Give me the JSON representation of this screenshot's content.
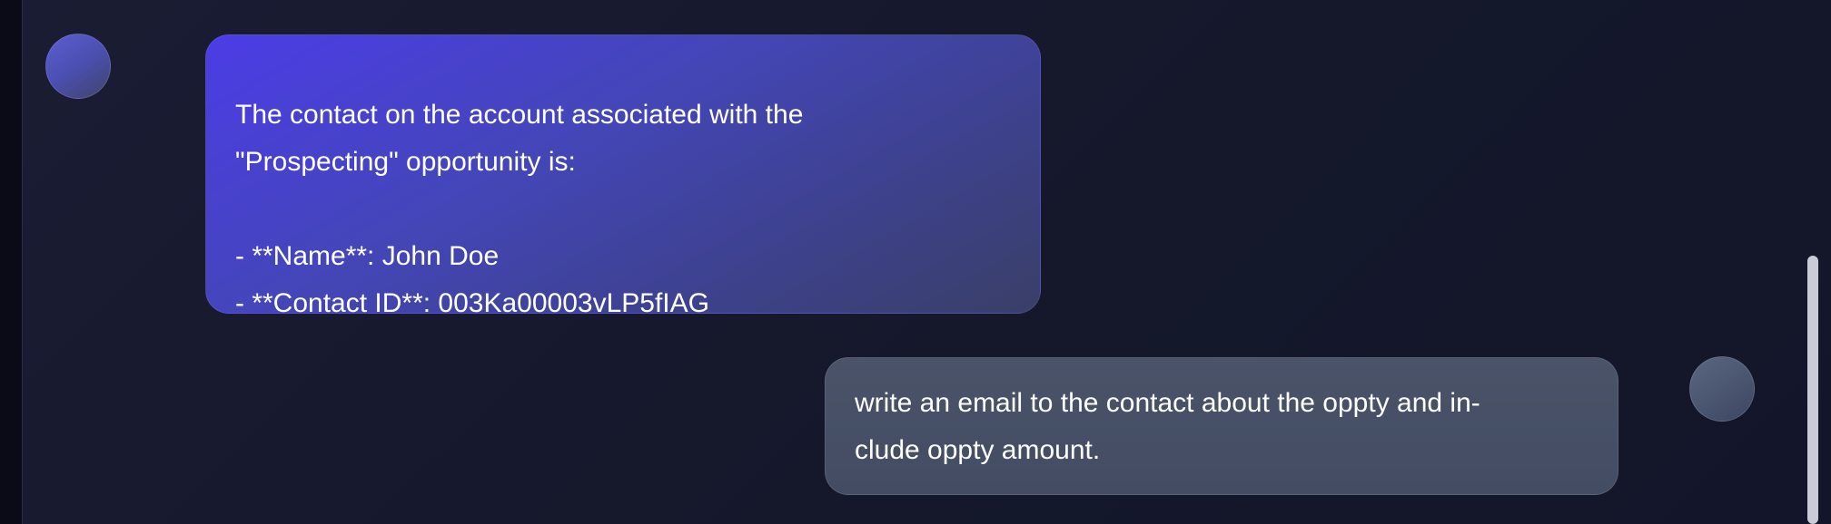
{
  "chat": {
    "messages": [
      {
        "role": "assistant",
        "text": "The contact on the account associated with the\n\"Prospecting\" opportunity is:\n\n- **Name**: John Doe\n- **Contact ID**: 003Ka00003vLP5fIAG"
      },
      {
        "role": "user",
        "text": "write an email to the contact about the oppty and in-\nclude oppty amount."
      }
    ]
  },
  "colors": {
    "background": "#15182b",
    "assistant_bubble": "#4c3ce6",
    "user_bubble": "#4a5368",
    "text": "#ffffff"
  },
  "icons": {
    "assistant_avatar": "assistant-avatar-icon",
    "user_avatar": "user-avatar-icon"
  }
}
